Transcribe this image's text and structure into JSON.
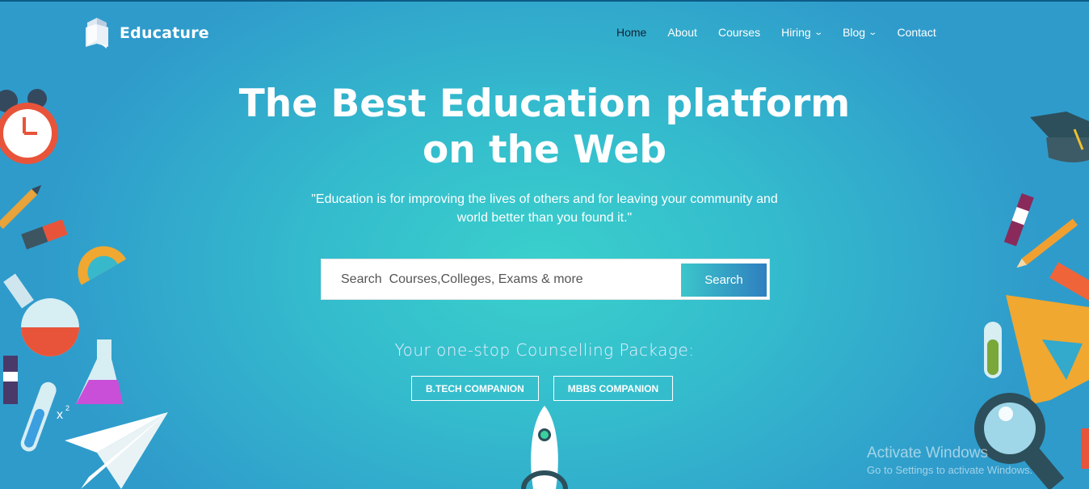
{
  "brand": {
    "name": "Educature",
    "icon": "book-logo-icon"
  },
  "nav": {
    "items": [
      {
        "label": "Home",
        "active": true
      },
      {
        "label": "About"
      },
      {
        "label": "Courses"
      },
      {
        "label": "Hiring",
        "dropdown": true
      },
      {
        "label": "Blog",
        "dropdown": true
      },
      {
        "label": "Contact"
      }
    ]
  },
  "hero": {
    "title_line1": "The Best Education platform",
    "title_line2": "on the Web",
    "quote_line1": "\"Education is for improving the lives of others and for leaving your community and",
    "quote_line2": "world better than you found it.\""
  },
  "search": {
    "placeholder": "Search  Courses,Colleges, Exams & more",
    "button": "Search"
  },
  "package": {
    "heading": "Your one-stop Counselling Package:",
    "buttons": [
      "B.TECH COMPANION",
      "MBBS COMPANION"
    ]
  },
  "watermark": {
    "line1": "Activate Windows",
    "line2": "Go to Settings to activate Windows."
  },
  "colors": {
    "background": "#34bccd",
    "button_gradient_start": "#3cc6cb",
    "button_gradient_end": "#2f7fbf"
  }
}
